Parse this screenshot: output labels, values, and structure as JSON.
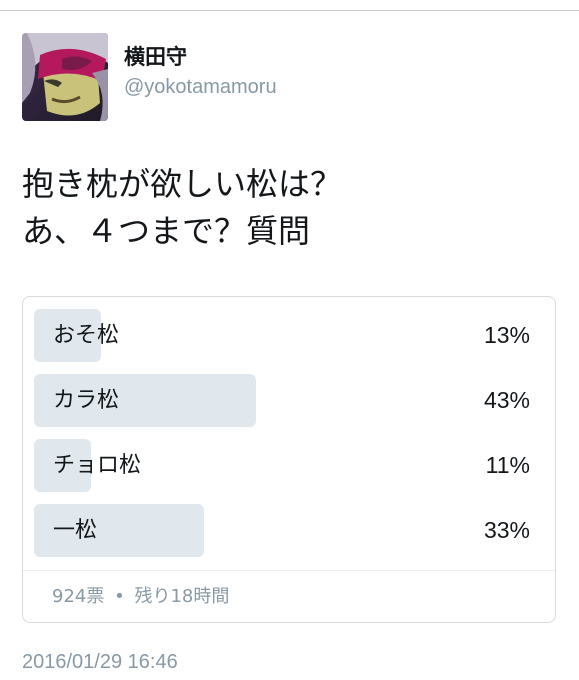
{
  "tweet": {
    "display_name": "横田守",
    "handle": "@yokotamamoru",
    "text_lines": [
      "抱き枕が欲しい松は？",
      "あ、４つまで？質問"
    ],
    "timestamp": "2016/01/29 16:46",
    "avatar": "user-avatar-anime-character"
  },
  "poll": {
    "options": [
      {
        "label": "おそ松",
        "percent_text": "13%",
        "percent": 13
      },
      {
        "label": "カラ松",
        "percent_text": "43%",
        "percent": 43
      },
      {
        "label": "チョロ松",
        "percent_text": "11%",
        "percent": 11
      },
      {
        "label": "一松",
        "percent_text": "33%",
        "percent": 33
      }
    ],
    "votes": "924票",
    "separator": "•",
    "remaining": "残り18時間"
  },
  "colors": {
    "bar": "#e1e8ed",
    "muted_text": "#8899a6",
    "text": "#14171a",
    "border": "#d6dce0"
  }
}
